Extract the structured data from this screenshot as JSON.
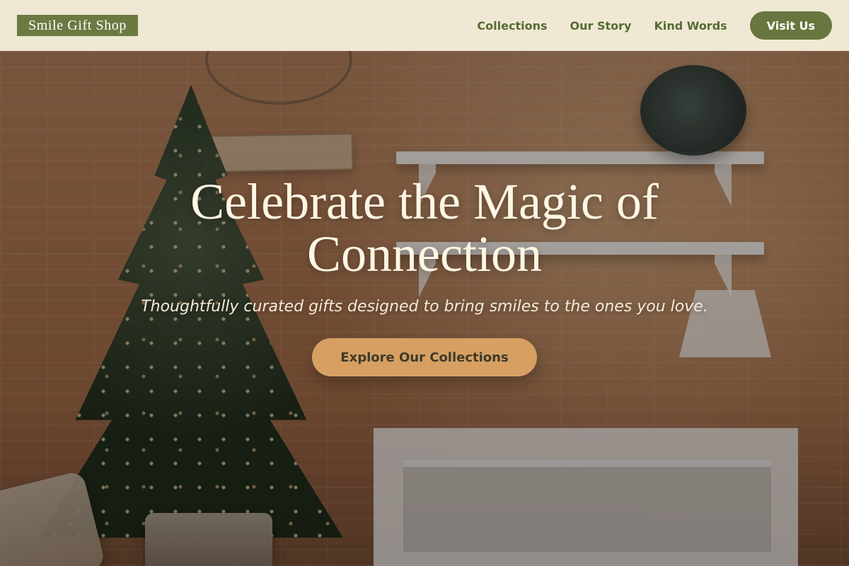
{
  "header": {
    "brand": "Smile Gift Shop",
    "nav": {
      "collections": "Collections",
      "our_story": "Our Story",
      "kind_words": "Kind Words",
      "visit_us": "Visit Us"
    }
  },
  "hero": {
    "title": "Celebrate the Magic of Connection",
    "subtitle": "Thoughtfully curated gifts designed to bring smiles to the ones you love.",
    "cta": "Explore Our Collections"
  },
  "colors": {
    "header_bg": "#F5F0DC",
    "brand_bg": "#6A7A41",
    "nav_text": "#566A33",
    "visit_button_bg": "#68773F",
    "cta_bg": "#D7A062",
    "cta_text": "#3F3A2A",
    "hero_text": "#FFF6E3"
  }
}
